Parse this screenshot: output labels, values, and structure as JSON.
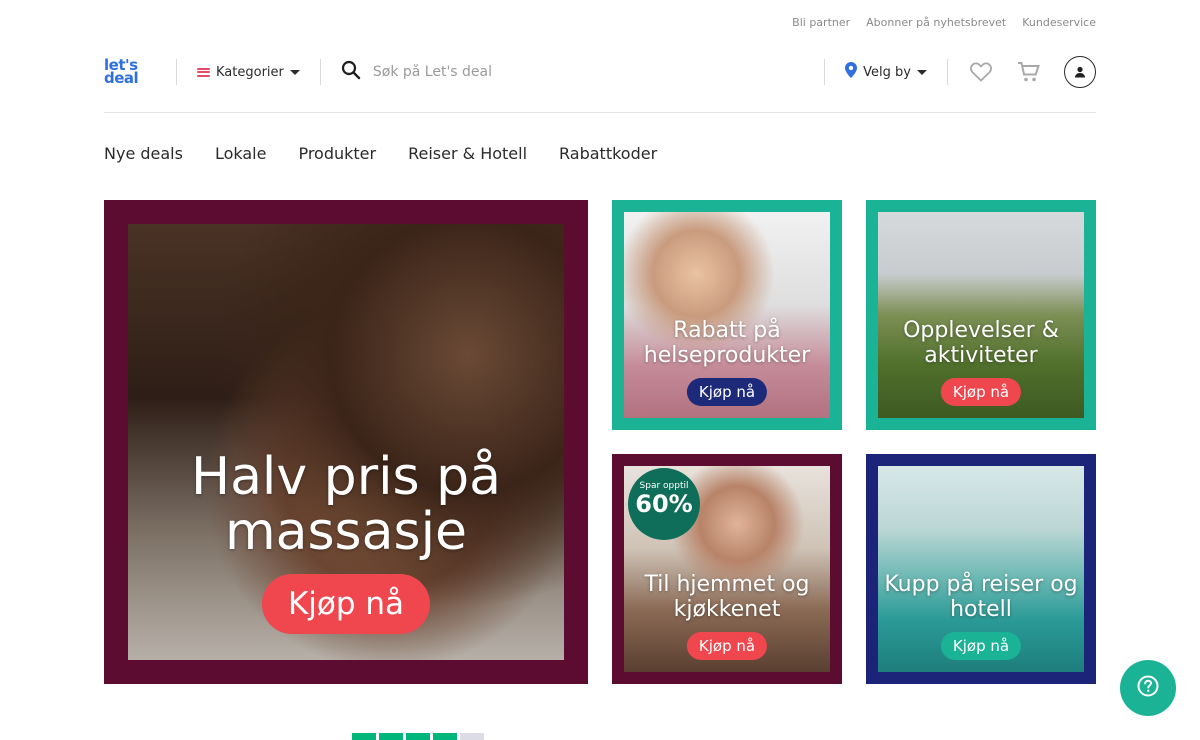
{
  "toplinks": [
    "Bli partner",
    "Abonner på nyhetsbrevet",
    "Kundeservice"
  ],
  "header": {
    "logo_line1": "let's",
    "logo_line2": "deal",
    "categories_label": "Kategorier",
    "search_placeholder": "Søk på Let's deal",
    "city_label": "Velg by"
  },
  "nav": [
    "Nye deals",
    "Lokale",
    "Produkter",
    "Reiser & Hotell",
    "Rabattkoder"
  ],
  "banners": {
    "main": {
      "title": "Halv pris på massasje",
      "cta": "Kjøp nå"
    },
    "health": {
      "title": "Rabatt på helseprodukter",
      "cta": "Kjøp nå"
    },
    "experiences": {
      "title": "Opplevelser & aktiviteter",
      "cta": "Kjøp nå"
    },
    "home": {
      "title": "Til hjemmet og kjøkkenet",
      "cta": "Kjøp nå",
      "badge_small": "Spar opptil",
      "badge_big": "60%"
    },
    "travel": {
      "title": "Kupp på reiser og hotell",
      "cta": "Kjøp nå"
    }
  },
  "colors": {
    "brand_blue": "#2f6fe0",
    "teal": "#1ab396",
    "maroon": "#5b0c30",
    "navy": "#1b2478",
    "cta_red": "#f0474f"
  },
  "trustpilot": {
    "stars_on": 4,
    "stars_total": 5
  }
}
